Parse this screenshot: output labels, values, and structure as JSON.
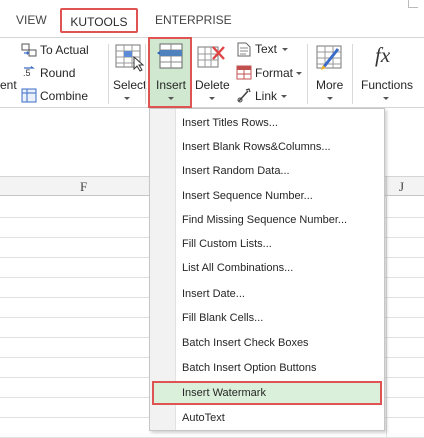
{
  "tabs": {
    "view": "VIEW",
    "kutools": "KUTOOLS",
    "enterprise": "ENTERPRISE"
  },
  "ribbon": {
    "cut_label": "ent",
    "to_actual": "To Actual",
    "round": "Round",
    "combine": "Combine",
    "select": "Select",
    "insert": "Insert",
    "delete": "Delete",
    "text": "Text",
    "format": "Format",
    "link": "Link",
    "more": "More",
    "functions": "Functions",
    "fx_symbol": "fx"
  },
  "sheet": {
    "col_f": "F",
    "col_j": "J"
  },
  "menu": {
    "items": [
      "Insert Titles Rows...",
      "Insert Blank Rows&Columns...",
      "Insert Random Data...",
      "Insert Sequence Number...",
      "Find Missing Sequence Number...",
      "Fill Custom Lists...",
      "List All Combinations...",
      "Insert Date...",
      "Fill Blank Cells...",
      "Batch Insert Check Boxes",
      "Batch Insert Option Buttons",
      "Insert Watermark",
      "AutoText"
    ],
    "active_item": "Insert Watermark"
  },
  "colors": {
    "highlight_border": "#e05353",
    "insert_bg": "#cfe8cf",
    "active_item_bg": "#daf0da"
  }
}
